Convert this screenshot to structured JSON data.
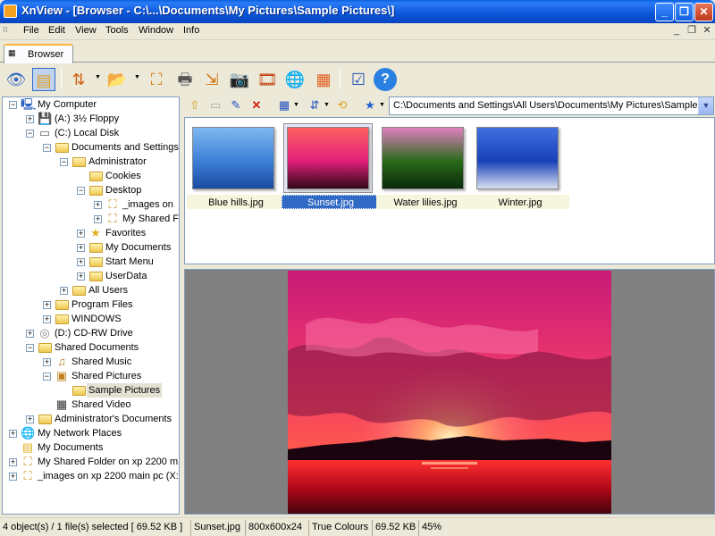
{
  "window": {
    "title": "XnView - [Browser - C:\\...\\Documents\\My Pictures\\Sample Pictures\\]",
    "minimize": "_",
    "maximize": "❐",
    "close": "✕"
  },
  "menu": {
    "items": [
      "File",
      "Edit",
      "View",
      "Tools",
      "Window",
      "Info"
    ],
    "mdi_min": "_",
    "mdi_restore": "❐",
    "mdi_close": "✕"
  },
  "tabs": [
    {
      "label": "Browser"
    }
  ],
  "toolbar": {
    "icons": [
      "eye-icon",
      "new-document-icon",
      "refresh-arrows-icon",
      "open-folder-icon",
      "zoom-fit-icon",
      "print-icon",
      "export-icon",
      "camera-icon",
      "film-strip-icon",
      "globe-icon",
      "mosaic-icon",
      "checklist-icon",
      "help-icon"
    ]
  },
  "tree": {
    "nodes": [
      {
        "label": "My Computer",
        "icon": "computer-icon",
        "level": 0,
        "exp": "−"
      },
      {
        "label": "(A:) 3½ Floppy",
        "icon": "floppy-icon",
        "level": 1,
        "exp": "+"
      },
      {
        "label": "(C:) Local Disk",
        "icon": "drive-icon",
        "level": 1,
        "exp": "−"
      },
      {
        "label": "Documents and Settings",
        "icon": "folder-icon",
        "level": 2,
        "exp": "−"
      },
      {
        "label": "Administrator",
        "icon": "folder-icon",
        "level": 3,
        "exp": "−"
      },
      {
        "label": "Cookies",
        "icon": "folder-icon",
        "level": 4,
        "exp": ""
      },
      {
        "label": "Desktop",
        "icon": "folder-icon",
        "level": 4,
        "exp": "−"
      },
      {
        "label": "_images on",
        "icon": "shared-folder-icon",
        "level": 5,
        "exp": "+"
      },
      {
        "label": "My Shared F",
        "icon": "shared-folder-icon",
        "level": 5,
        "exp": "+"
      },
      {
        "label": "Favorites",
        "icon": "star-icon",
        "level": 4,
        "exp": "+"
      },
      {
        "label": "My Documents",
        "icon": "folder-icon",
        "level": 4,
        "exp": "+"
      },
      {
        "label": "Start Menu",
        "icon": "folder-icon",
        "level": 4,
        "exp": "+"
      },
      {
        "label": "UserData",
        "icon": "folder-icon",
        "level": 4,
        "exp": "+"
      },
      {
        "label": "All Users",
        "icon": "folder-icon",
        "level": 3,
        "exp": "+"
      },
      {
        "label": "Program Files",
        "icon": "folder-icon",
        "level": 2,
        "exp": "+"
      },
      {
        "label": "WINDOWS",
        "icon": "folder-icon",
        "level": 2,
        "exp": "+"
      },
      {
        "label": "(D:) CD-RW Drive",
        "icon": "cd-icon",
        "level": 1,
        "exp": "+"
      },
      {
        "label": "Shared Documents",
        "icon": "folder-icon",
        "level": 1,
        "exp": "−"
      },
      {
        "label": "Shared Music",
        "icon": "music-folder-icon",
        "level": 2,
        "exp": "+"
      },
      {
        "label": "Shared Pictures",
        "icon": "pictures-folder-icon",
        "level": 2,
        "exp": "−"
      },
      {
        "label": "Sample Pictures",
        "icon": "folder-icon",
        "level": 3,
        "exp": "",
        "selected": true
      },
      {
        "label": "Shared Video",
        "icon": "video-folder-icon",
        "level": 2,
        "exp": ""
      },
      {
        "label": "Administrator's Documents",
        "icon": "folder-icon",
        "level": 1,
        "exp": "+"
      },
      {
        "label": "My Network Places",
        "icon": "network-icon",
        "level": 0,
        "exp": "+"
      },
      {
        "label": "My Documents",
        "icon": "documents-icon",
        "level": 0,
        "exp": ""
      },
      {
        "label": "My Shared Folder on xp 2200 m",
        "icon": "shared-folder-icon",
        "level": 0,
        "exp": "+"
      },
      {
        "label": "_images on xp 2200 main pc (X:",
        "icon": "shared-folder-icon",
        "level": 0,
        "exp": "+"
      }
    ]
  },
  "subtoolbar": {
    "icons": [
      "up-folder-icon",
      "new-folder-icon",
      "rename-icon",
      "delete-icon",
      "view-mode-icon",
      "sort-icon",
      "sync-icon",
      "favorite-star-icon"
    ],
    "path": "C:\\Documents and Settings\\All Users\\Documents\\My Pictures\\Sample P"
  },
  "thumbnails": [
    {
      "name": "Blue hills.jpg",
      "selected": false,
      "palette": [
        "#3d7fd8",
        "#7fb7f0",
        "#1a4aa0"
      ]
    },
    {
      "name": "Sunset.jpg",
      "selected": true,
      "palette": [
        "#e0207a",
        "#ff6060",
        "#300818"
      ]
    },
    {
      "name": "Water lilies.jpg",
      "selected": false,
      "palette": [
        "#2a6a1a",
        "#e080c0",
        "#0a2a0a"
      ]
    },
    {
      "name": "Winter.jpg",
      "selected": false,
      "palette": [
        "#1840b8",
        "#4070e0",
        "#d8e0f0"
      ]
    }
  ],
  "preview": {
    "image": "Sunset.jpg"
  },
  "status": {
    "objects": "4 object(s) / 1 file(s) selected  [ 69.52 KB ]",
    "file": "Sunset.jpg",
    "dims": "800x600x24",
    "colours": "True Colours",
    "size": "69.52 KB",
    "zoom": "45%"
  }
}
